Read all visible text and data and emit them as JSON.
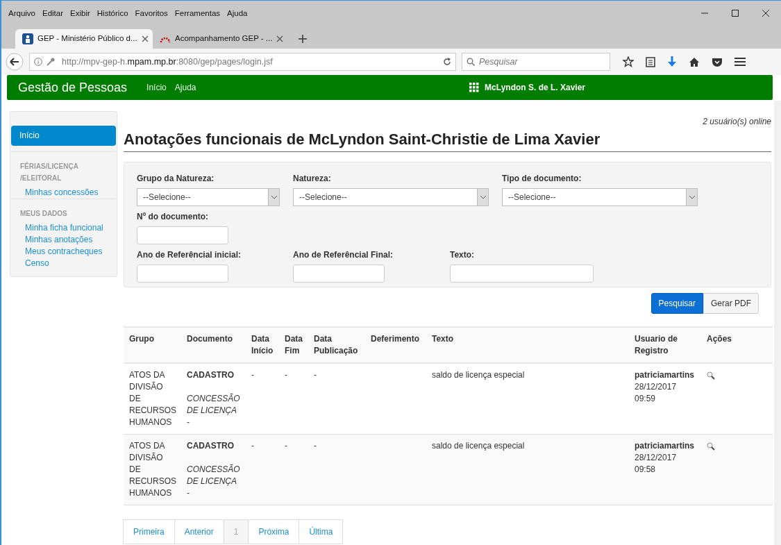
{
  "browser": {
    "menu": [
      "Arquivo",
      "Editar",
      "Exibir",
      "Histórico",
      "Favoritos",
      "Ferramentas",
      "Ajuda"
    ],
    "tabs": [
      {
        "label": "GEP - Ministério Público d...",
        "selected": true
      },
      {
        "label": "Acompanhamento GEP - ...",
        "selected": false
      }
    ],
    "url": "http://mpv-gep-h.**mpam.mp.br**:8080/gep/pages/login.jsf",
    "search": {
      "placeholder": "Pesquisar"
    }
  },
  "navbar": {
    "brand": "Gestão de Pessoas",
    "links": [
      "Início",
      "Ajuda"
    ],
    "user": "McLyndon S. de L. Xavier"
  },
  "sidebar": {
    "items": [
      {
        "kind": "link",
        "label": "Início",
        "selected": true
      },
      {
        "kind": "heading",
        "label": "FÉRIAS/LICENÇA /ELEITORAL"
      },
      {
        "kind": "link",
        "label": "Minhas concessões",
        "selected": false
      },
      {
        "kind": "heading",
        "label": "MEUS DADOS"
      },
      {
        "kind": "link",
        "label": "Minha ficha funcional",
        "selected": false
      },
      {
        "kind": "link",
        "label": "Minhas anotações",
        "selected": false
      },
      {
        "kind": "link",
        "label": "Meus contracheques",
        "selected": false
      },
      {
        "kind": "link",
        "label": "Censo",
        "selected": false
      }
    ]
  },
  "online": "2 usuário(s) online",
  "title": "Anotações funcionais de McLyndon Saint-Christie de Lima Xavier",
  "filters": [
    [
      {
        "kind": "select",
        "label": "Grupo da Natureza:",
        "value": "--Selecione--"
      },
      {
        "kind": "select",
        "label": "Natureza:",
        "value": "--Selecione--"
      },
      {
        "kind": "select",
        "label": "Tipo de documento:",
        "value": "--Selecione--"
      }
    ],
    [
      {
        "kind": "text",
        "label": "Nº do documento:"
      }
    ],
    [
      {
        "kind": "text",
        "label": "Ano de Referêncial inicial:"
      },
      {
        "kind": "text",
        "label": "Ano de Referêncial Final:"
      },
      {
        "kind": "wide",
        "label": "Texto:"
      }
    ]
  ],
  "buttons": [
    {
      "kind": "primary",
      "label": "Pesquisar"
    },
    {
      "kind": "default",
      "label": "Gerar PDF"
    }
  ],
  "table": {
    "columns": [
      "Grupo",
      "Documento",
      "Data Início",
      "Data Fim",
      "Data Publicação",
      "Deferimento",
      "Texto",
      "Usuario de Registro",
      "Ações"
    ],
    "rows": [
      {
        "grupo": "ATOS DA DIVISÃO DE RECURSOS HUMANOS",
        "documento": "CADASTRO",
        "natureza": "CONCESSÃO DE LICENÇA",
        "numero": "-",
        "data_inicio": "-",
        "data_fim": "-",
        "data_publicacao": "-",
        "texto": "saldo de licença especial",
        "usuario": "patriciamartins",
        "data": "28/12/2017",
        "hora": "09:59"
      },
      {
        "grupo": "ATOS DA DIVISÃO DE RECURSOS HUMANOS",
        "documento": "CADASTRO",
        "natureza": "CONCESSÃO DE LICENÇA",
        "numero": "-",
        "data_inicio": "-",
        "data_fim": "-",
        "data_publicacao": "-",
        "texto": "saldo de licença especial",
        "usuario": "patriciamartins",
        "data": "28/12/2017",
        "hora": "09:58"
      }
    ]
  },
  "pagination": [
    {
      "label": "Primeira",
      "selected": false
    },
    {
      "label": "Anterior",
      "selected": false
    },
    {
      "label": "1",
      "selected": true
    },
    {
      "label": "Próxima",
      "selected": false
    },
    {
      "label": "Última",
      "selected": false
    }
  ]
}
